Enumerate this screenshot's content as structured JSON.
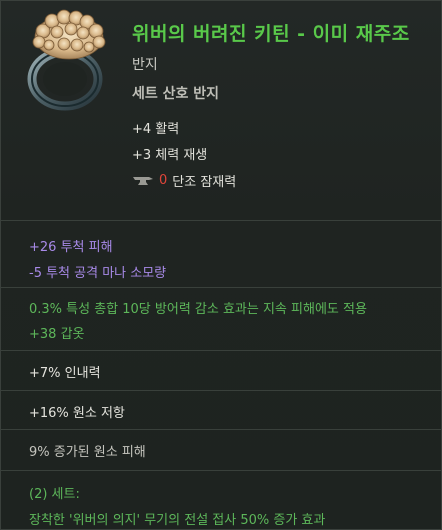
{
  "item": {
    "title": "위버의 버려진 키틴 - 이미 재주조",
    "type": "반지",
    "set_type": "세트 산호 반지",
    "icon": "coral-ring-icon",
    "base_stats": [
      "+4 활력",
      "+3 체력 재생"
    ],
    "forge": {
      "icon": "anvil-icon",
      "value": "0",
      "label": "단조 잠재력"
    }
  },
  "affixes": {
    "sealed": [
      "+26 투척 피해",
      "-5 투척 공격 마나 소모량"
    ],
    "set_implicit": [
      "0.3% 특성 총합 10당 방어력 감소 효과는 지속 피해에도 적용",
      "+38 갑옷"
    ],
    "prefix_suffix": [
      "+7% 인내력",
      "+16% 원소 저항",
      "9% 증가된 원소 피해"
    ]
  },
  "set_bonus": {
    "header": "(2) 세트:",
    "text": "장착한 '위버의 의지' 무기의 전설 접사 50% 증가 효과"
  },
  "colors": {
    "title": "#59c94a",
    "purple_affix": "#a88ae8",
    "green_affix": "#5db75a",
    "forge_zero": "#e0453a",
    "background": "#1f2421"
  }
}
